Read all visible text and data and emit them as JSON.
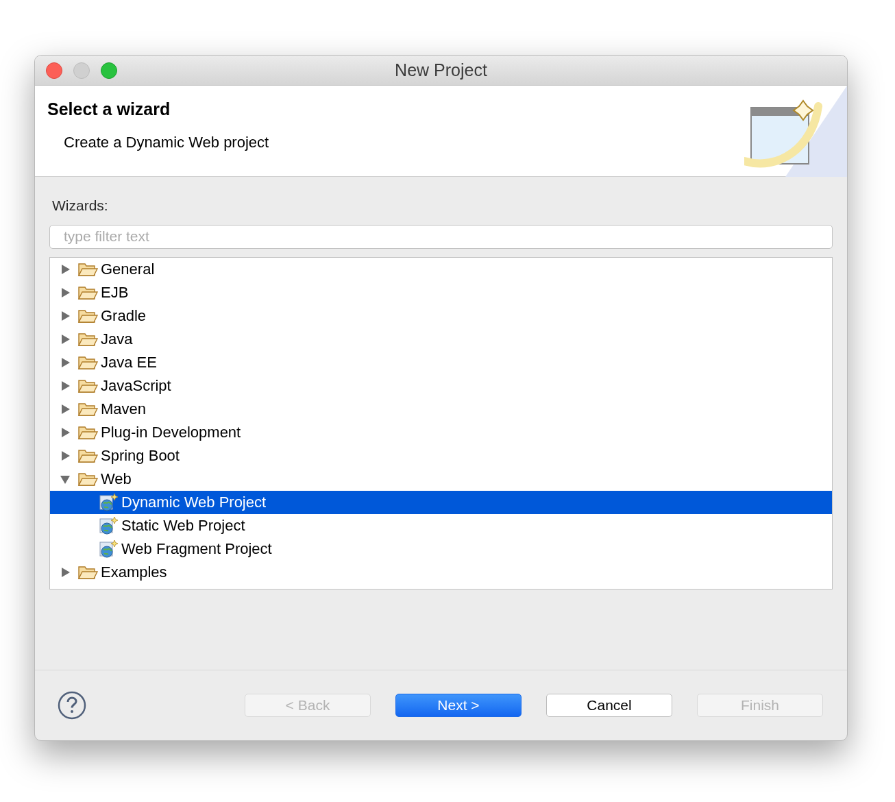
{
  "window": {
    "title": "New Project"
  },
  "header": {
    "title": "Select a wizard",
    "description": "Create a Dynamic Web project"
  },
  "wizards": {
    "label": "Wizards:",
    "filter": {
      "placeholder": "type filter text"
    },
    "tree": [
      {
        "label": "General",
        "kind": "folder",
        "expanded": false,
        "selected": false
      },
      {
        "label": "EJB",
        "kind": "folder",
        "expanded": false,
        "selected": false
      },
      {
        "label": "Gradle",
        "kind": "folder",
        "expanded": false,
        "selected": false
      },
      {
        "label": "Java",
        "kind": "folder",
        "expanded": false,
        "selected": false
      },
      {
        "label": "Java EE",
        "kind": "folder",
        "expanded": false,
        "selected": false
      },
      {
        "label": "JavaScript",
        "kind": "folder",
        "expanded": false,
        "selected": false
      },
      {
        "label": "Maven",
        "kind": "folder",
        "expanded": false,
        "selected": false
      },
      {
        "label": "Plug-in Development",
        "kind": "folder",
        "expanded": false,
        "selected": false
      },
      {
        "label": "Spring Boot",
        "kind": "folder",
        "expanded": false,
        "selected": false
      },
      {
        "label": "Web",
        "kind": "folder",
        "expanded": true,
        "selected": false,
        "children": [
          {
            "label": "Dynamic Web Project",
            "kind": "wizard",
            "selected": true
          },
          {
            "label": "Static Web Project",
            "kind": "wizard",
            "selected": false
          },
          {
            "label": "Web Fragment Project",
            "kind": "wizard",
            "selected": false
          }
        ]
      },
      {
        "label": "Examples",
        "kind": "folder",
        "expanded": false,
        "selected": false
      }
    ]
  },
  "buttons": [
    {
      "label": "< Back",
      "kind": "normal",
      "disabled": true
    },
    {
      "label": "Next >",
      "kind": "default",
      "disabled": false
    },
    {
      "label": "Cancel",
      "kind": "normal",
      "disabled": false
    },
    {
      "label": "Finish",
      "kind": "normal",
      "disabled": true
    }
  ]
}
